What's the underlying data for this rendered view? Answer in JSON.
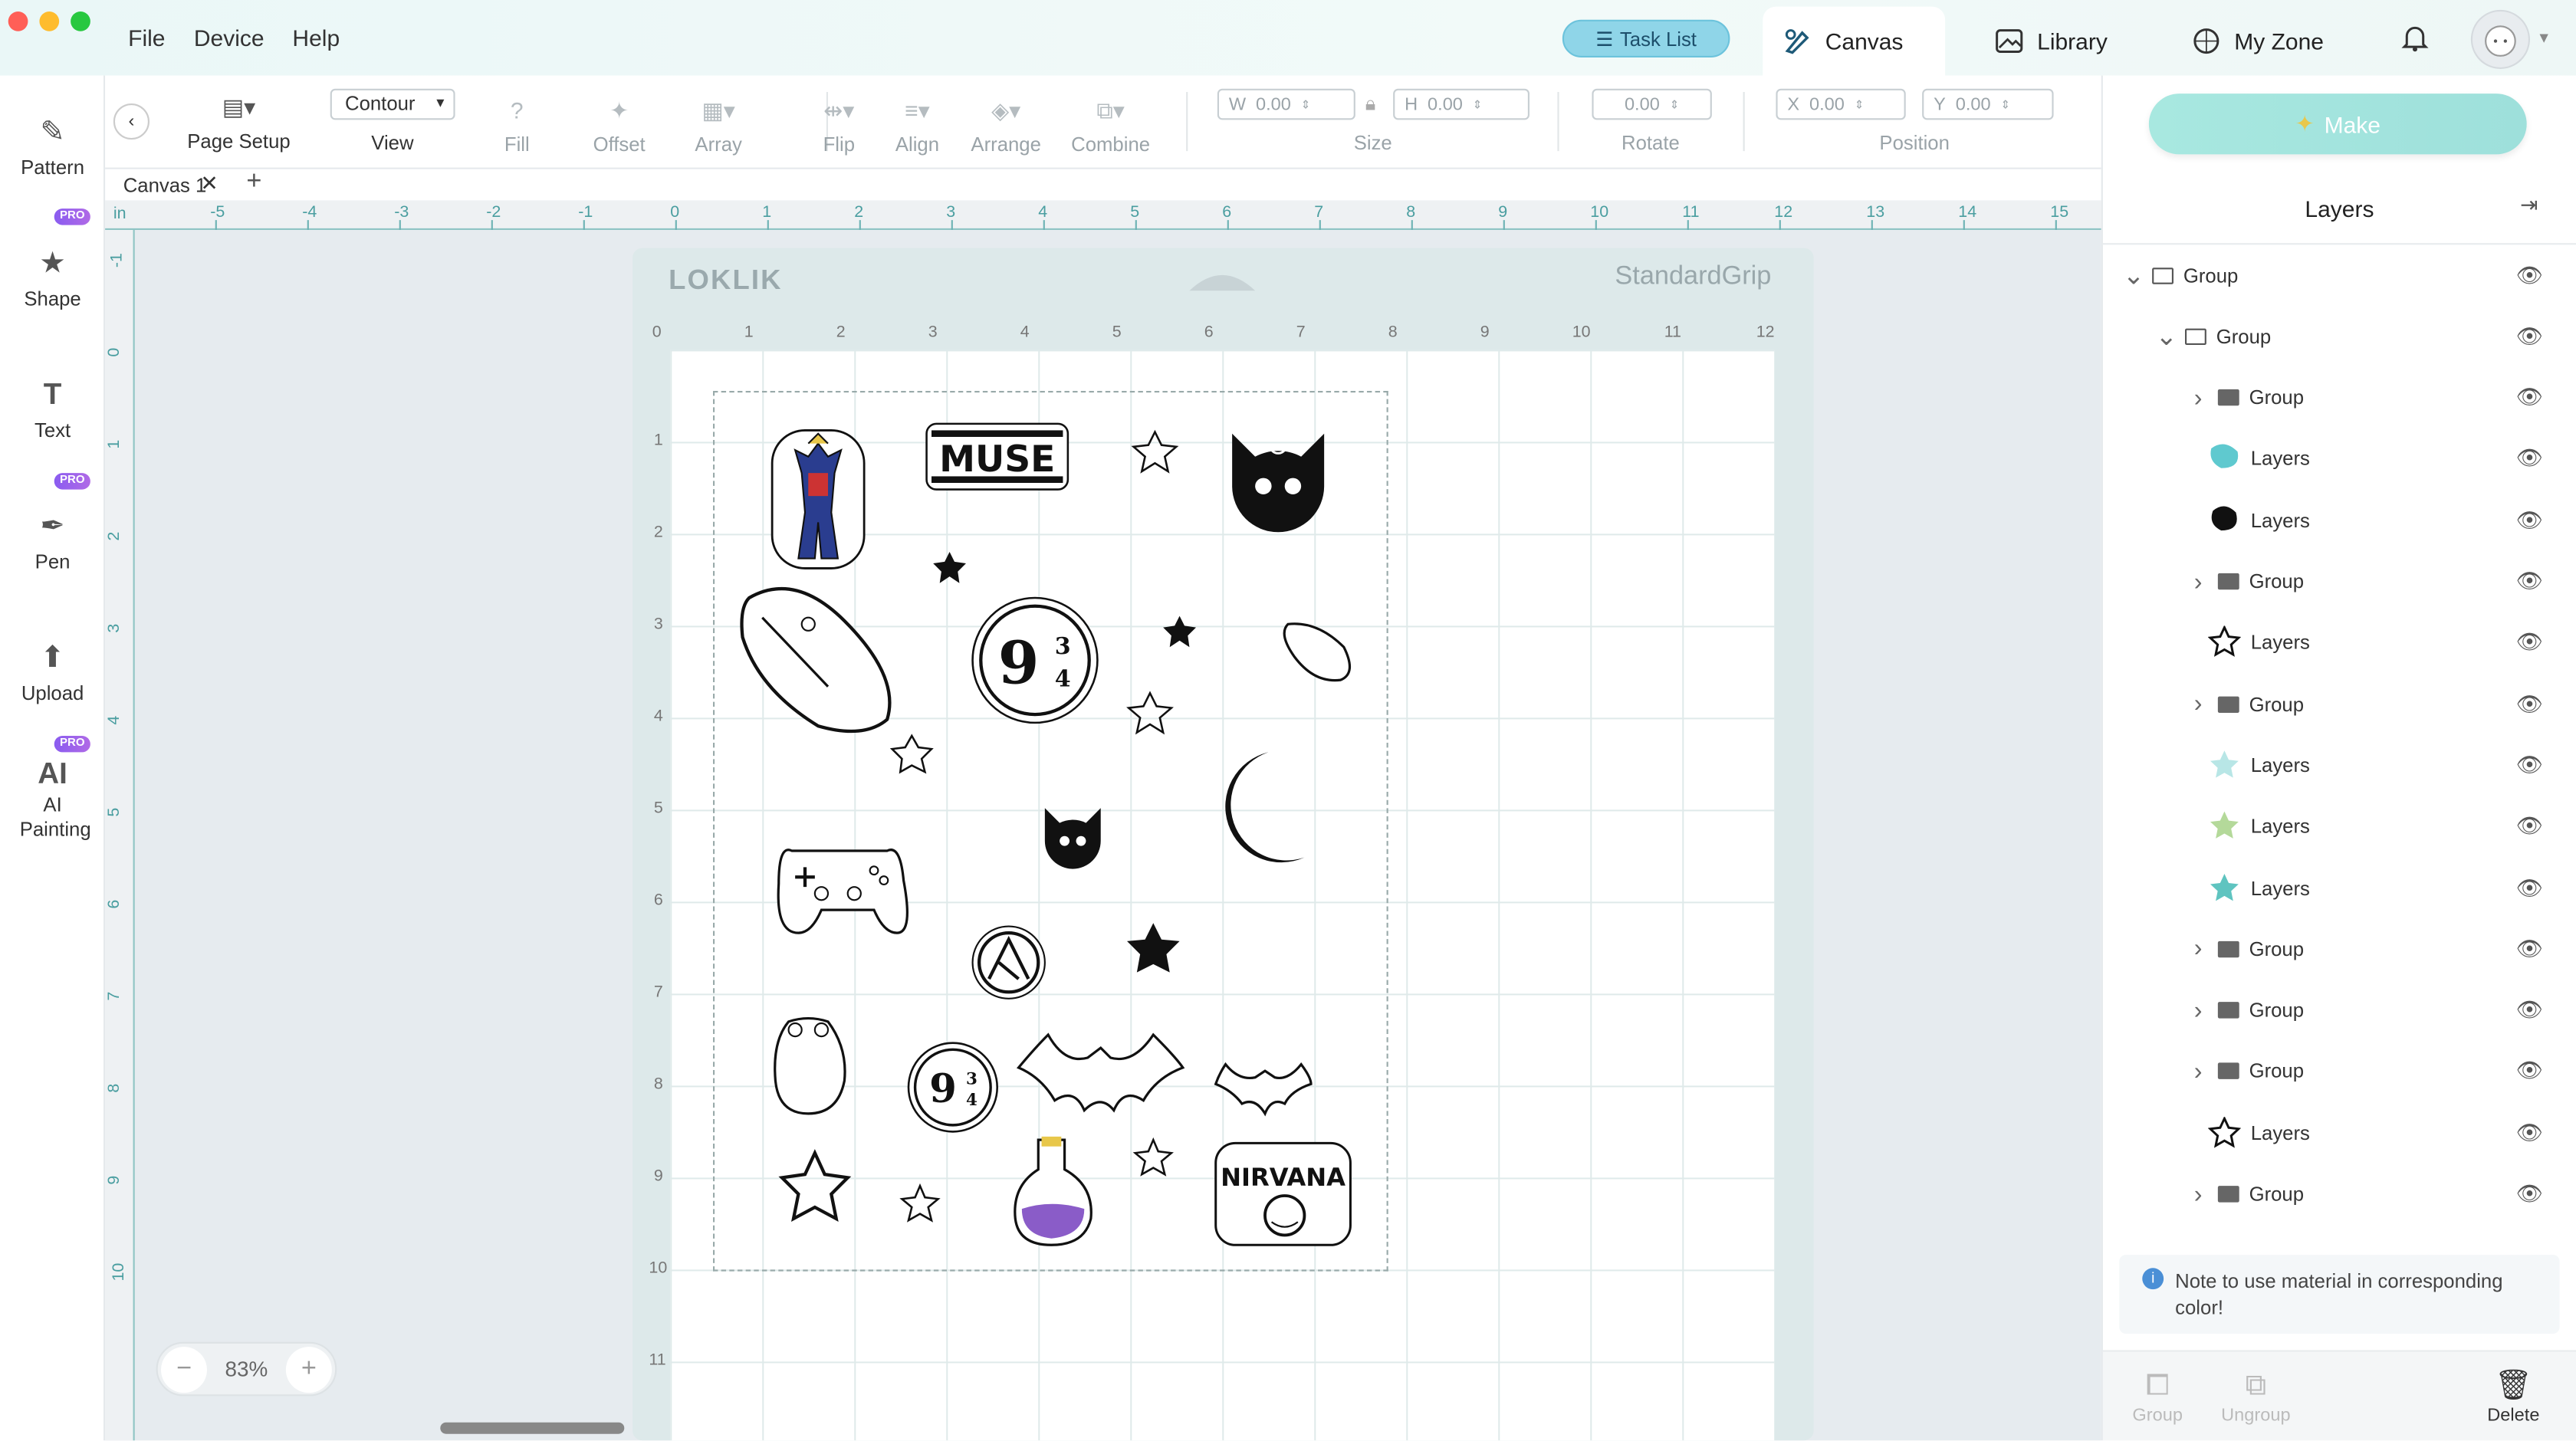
{
  "menu": {
    "file": "File",
    "device": "Device",
    "help": "Help"
  },
  "header": {
    "task_list": "Task List",
    "tabs": [
      "Canvas",
      "Library",
      "My Zone"
    ]
  },
  "toolbar": {
    "page_setup": "Page Setup",
    "view_value": "Contour",
    "view_label": "View",
    "fill": "Fill",
    "offset": "Offset",
    "array": "Array",
    "flip": "Flip",
    "align": "Align",
    "arrange": "Arrange",
    "combine": "Combine",
    "size_label": "Size",
    "w_label": "W",
    "w_value": "0.00",
    "h_label": "H",
    "h_value": "0.00",
    "rotate_label": "Rotate",
    "rotate_value": "0.00",
    "position_label": "Position",
    "x_label": "X",
    "x_value": "0.00",
    "y_label": "Y",
    "y_value": "0.00"
  },
  "make": {
    "label": "Make"
  },
  "sidebar": {
    "items": [
      "Pattern",
      "Shape",
      "Text",
      "Pen",
      "Upload",
      "AI Painting"
    ],
    "pro": "PRO"
  },
  "doc": {
    "tab": "Canvas 1"
  },
  "ruler": {
    "unit": "in",
    "h": [
      "-5",
      "-4",
      "-3",
      "-2",
      "-1",
      "0",
      "1",
      "2",
      "3",
      "4",
      "5",
      "6",
      "7",
      "8",
      "9",
      "10",
      "11",
      "12",
      "13",
      "14",
      "15"
    ],
    "v": [
      "-1",
      "0",
      "1",
      "2",
      "3",
      "4",
      "5",
      "6",
      "7",
      "8",
      "9",
      "10"
    ]
  },
  "mat": {
    "brand": "LOKLIK",
    "grip": "StandardGrip",
    "h": [
      "0",
      "1",
      "2",
      "3",
      "4",
      "5",
      "6",
      "7",
      "8",
      "9",
      "10",
      "11",
      "12"
    ],
    "v": [
      "1",
      "2",
      "3",
      "4",
      "5",
      "6",
      "7",
      "8",
      "9",
      "10",
      "11"
    ]
  },
  "stickers": {
    "muse": "MUSE",
    "nirvana": "NIRVANA",
    "platform": "9",
    "frac_top": "3",
    "frac_bot": "4"
  },
  "zoom": {
    "value": "83%",
    "minus": "−",
    "plus": "+"
  },
  "layers": {
    "title": "Layers",
    "rows": [
      {
        "label": "Group",
        "type": "group"
      },
      {
        "label": "Group",
        "type": "group"
      },
      {
        "label": "Group",
        "type": "group"
      },
      {
        "label": "Layers",
        "type": "teal-blob"
      },
      {
        "label": "Layers",
        "type": "black-blob"
      },
      {
        "label": "Group",
        "type": "group"
      },
      {
        "label": "Layers",
        "type": "star-outline"
      },
      {
        "label": "Group",
        "type": "group"
      },
      {
        "label": "Layers",
        "type": "star-light"
      },
      {
        "label": "Layers",
        "type": "star-green"
      },
      {
        "label": "Layers",
        "type": "star-teal"
      },
      {
        "label": "Group",
        "type": "group"
      },
      {
        "label": "Group",
        "type": "group"
      },
      {
        "label": "Group",
        "type": "group"
      },
      {
        "label": "Layers",
        "type": "star-outline"
      },
      {
        "label": "Group",
        "type": "group"
      }
    ]
  },
  "note": "Note to use material in corresponding color!",
  "bottom": {
    "group": "Group",
    "ungroup": "Ungroup",
    "delete": "Delete"
  },
  "colors": {
    "accent": "#5fc4c0",
    "make": "#a8e8e0",
    "pro": "#8a5cf0"
  }
}
